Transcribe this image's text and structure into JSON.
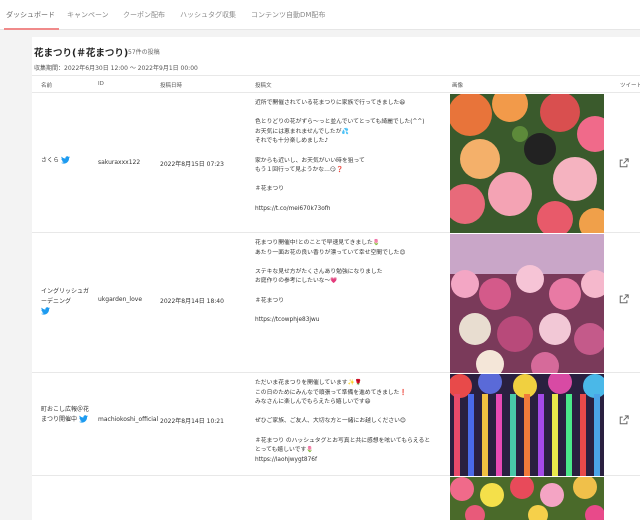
{
  "tabs": [
    "ダッシュボード",
    "キャンペーン",
    "クーポン配布",
    "ハッシュタグ収集",
    "コンテンツ自動DM配布"
  ],
  "header": {
    "title": "花まつり(＃花まつり)",
    "count": "57件の投稿",
    "period": "収集期間：2022年6月30日 12:00 ～ 2022年9月1日 00:00"
  },
  "columns": [
    "名前",
    "ID",
    "投稿日時",
    "投稿文",
    "画像",
    "ツイート"
  ],
  "rows": [
    {
      "name": "さくら",
      "id": "sakuraxxx122",
      "date": "2022年8月15日 07:23",
      "lines": [
        "近所で開催されている花まつりに家族で行ってきました😆",
        "",
        "色とりどりの花がずら〜っと並んでいてとっても綺麗でした(^^)",
        "お天気には恵まれませんでしたが💦",
        "それでも十分楽しめました♪",
        "",
        "家からも近いし、お天気がいい時を狙って",
        "もう１回行って見ようかな…😏❓",
        "",
        "＃花まつり",
        "",
        "https://t.co/mei670k73ofh"
      ]
    },
    {
      "name": "イングリッシュガーデニング",
      "id": "ukgarden_love",
      "date": "2022年8月14日 18:40",
      "lines": [
        "花まつり開催中!とのことで早速見てきました🌷",
        "あたり一面お花の良い香りが漂っていて幸せ空間でした😊",
        "",
        "ステキな見せ方がたくさんあり勉強になりました",
        "お庭作りの参考にしたいな〜💗",
        "",
        "＃花まつり",
        "",
        "https://tcowphje83jwu"
      ]
    },
    {
      "name": "町おこし広報＠花まつり開催中",
      "id": "machiokoshi_official",
      "date": "2022年8月14日 10:21",
      "lines": [
        "ただいま花まつりを開催しています✨🌹",
        "この日のためにみんなで頑張って準備を進めてきました❗",
        "みなさんに楽しんでもらえたら嬉しいです😄",
        "",
        "ぜひご家族、ご友人、大切な方と一緒にお越しください😊",
        "",
        "＃花まつり のハッシュタグとお写真と共に感想を呟いてもらえると",
        "とっても嬉しいです🌷",
        "https://laohjwygt876f"
      ]
    }
  ],
  "colors": {
    "accent": "#f08a8a",
    "twitter": "#1d9bf0",
    "border": "#e8e8e8"
  },
  "icons": [
    "twitter-bird-icon",
    "external-link-icon"
  ]
}
